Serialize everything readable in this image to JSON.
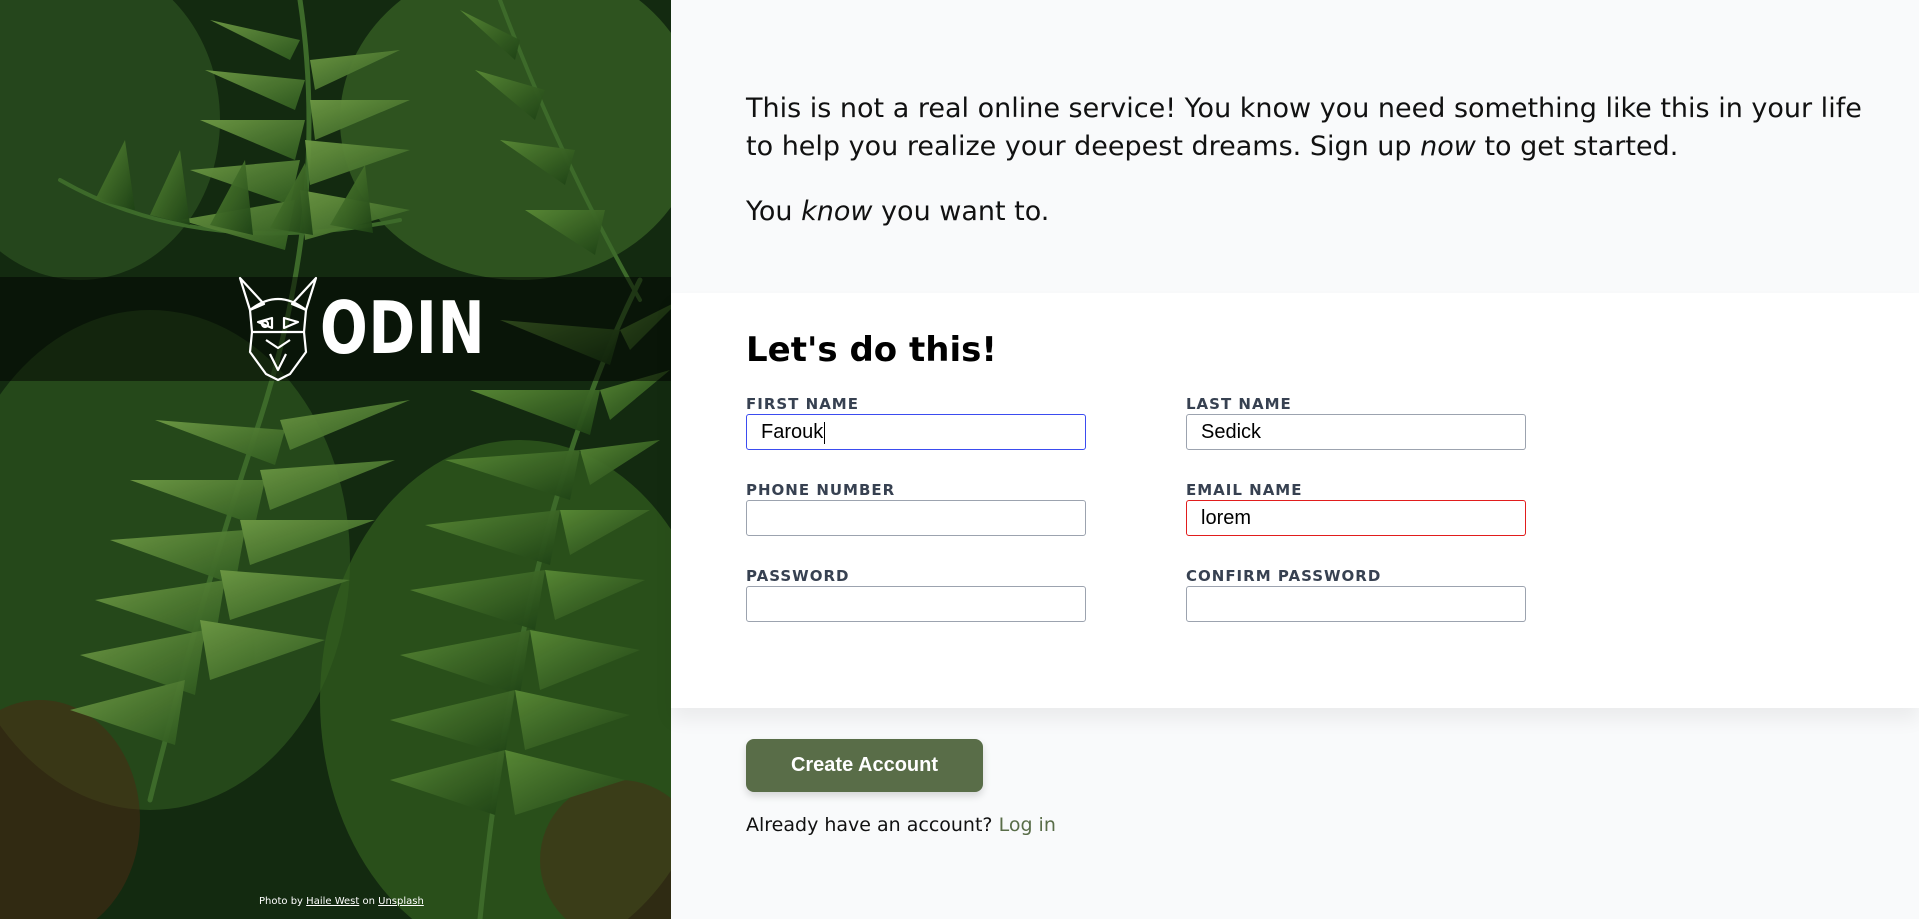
{
  "hero": {
    "logo_text": "ODIN",
    "credit": {
      "prefix": "Photo by",
      "author": "Haile West",
      "middle": "on",
      "source": "Unsplash"
    }
  },
  "intro": {
    "para1_start": "This is not a real online service! You know you need something like this in your life to help you realize your deepest dreams. Sign up ",
    "para1_em": "now",
    "para1_end": " to get started.",
    "para2_start": "You ",
    "para2_em": "know",
    "para2_end": " you want to."
  },
  "form": {
    "title": "Let's do this!",
    "fields": {
      "first_name": {
        "label": "FIRST NAME",
        "value": "Farouk",
        "state": "focused"
      },
      "last_name": {
        "label": "LAST NAME",
        "value": "Sedick",
        "state": "normal"
      },
      "phone": {
        "label": "PHONE NUMBER",
        "value": "",
        "state": "normal"
      },
      "email": {
        "label": "EMAIL NAME",
        "value": "lorem",
        "state": "invalid"
      },
      "password": {
        "label": "PASSWORD",
        "value": "",
        "state": "normal"
      },
      "confirm_password": {
        "label": "CONFIRM PASSWORD",
        "value": "",
        "state": "normal"
      }
    }
  },
  "actions": {
    "create_label": "Create Account",
    "login_prompt": "Already have an account?",
    "login_link": "Log in"
  },
  "colors": {
    "accent": "#596d48",
    "focus_border": "#3b4cf0",
    "error_border": "#e11d1d"
  }
}
